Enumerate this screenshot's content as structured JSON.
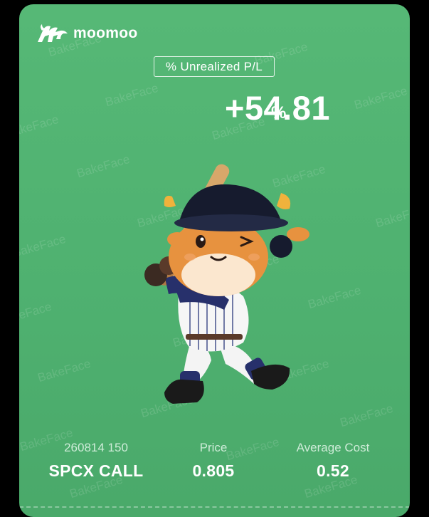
{
  "brand": {
    "name": "moomoo",
    "logo_icon": "bull-logo-icon"
  },
  "pnl": {
    "label": "% Unrealized P/L",
    "value": "+54.81",
    "unit": "%"
  },
  "illustration": {
    "icon": "bull-baseball-mascot-icon"
  },
  "watermark_text": "BakeFace",
  "stats": {
    "contract": {
      "label": "260814 150",
      "value": "SPCX CALL"
    },
    "price": {
      "label": "Price",
      "value": "0.805"
    },
    "average_cost": {
      "label": "Average Cost",
      "value": "0.52"
    }
  },
  "colors": {
    "card_background": "#52b473",
    "page_background": "#000000",
    "text": "#ffffff"
  }
}
